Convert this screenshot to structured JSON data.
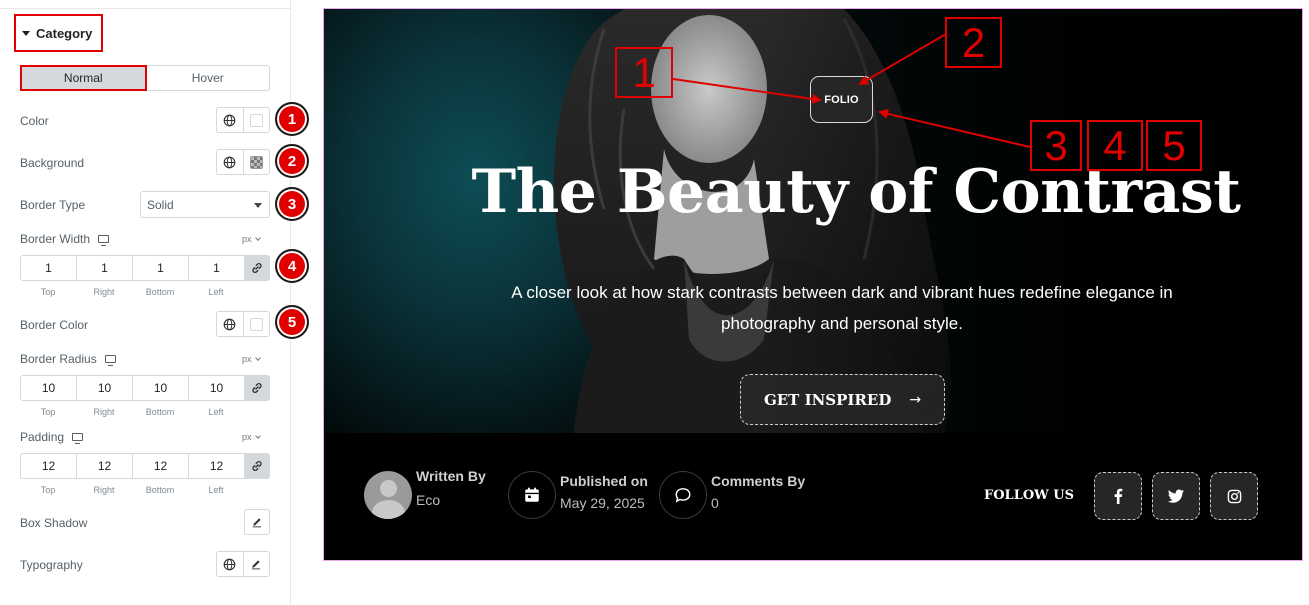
{
  "panel": {
    "section_title": "Category",
    "tabs": [
      {
        "label": "Normal",
        "active": true
      },
      {
        "label": "Hover",
        "active": false
      }
    ],
    "color_label": "Color",
    "background_label": "Background",
    "border_type_label": "Border Type",
    "border_type_value": "Solid",
    "border_width_label": "Border Width",
    "border_width_unit": "px",
    "border_width": {
      "top": "1",
      "right": "1",
      "bottom": "1",
      "left": "1"
    },
    "border_color_label": "Border Color",
    "border_radius_label": "Border Radius",
    "border_radius_unit": "px",
    "border_radius": {
      "top": "10",
      "right": "10",
      "bottom": "10",
      "left": "10"
    },
    "padding_label": "Padding",
    "padding_unit": "px",
    "padding": {
      "top": "12",
      "right": "12",
      "bottom": "12",
      "left": "12"
    },
    "side_captions": {
      "top": "Top",
      "right": "Right",
      "bottom": "Bottom",
      "left": "Left"
    },
    "box_shadow_label": "Box Shadow",
    "typography_label": "Typography",
    "badges": [
      "1",
      "2",
      "3",
      "4",
      "5"
    ]
  },
  "preview": {
    "category": "FOLIO",
    "title": "The Beauty of Contrast",
    "subtitle": "A closer look at how stark contrasts between dark and vibrant hues redefine elegance in photography and personal style.",
    "cta_label": "GET INSPIRED",
    "cta_arrow": "→",
    "author_caption": "Written By",
    "author_name": "Eco",
    "published_caption": "Published on",
    "published_date": "May 29, 2025",
    "comments_caption": "Comments By",
    "comments_count": "0",
    "follow_label": "FOLLOW US",
    "social": [
      "facebook-icon",
      "twitter-icon",
      "instagram-icon"
    ]
  },
  "annotations": [
    "1",
    "2",
    "3",
    "4",
    "5"
  ],
  "colors": {
    "accent_red": "#e00000",
    "panel_border": "#d5d8dc",
    "preview_frame": "#e7a7ea"
  }
}
